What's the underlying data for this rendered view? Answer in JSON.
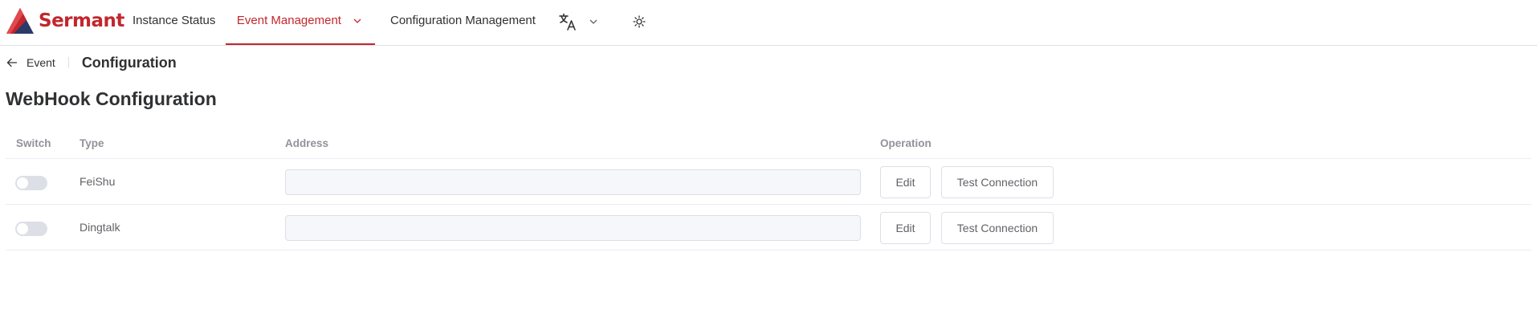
{
  "app": {
    "logo_text": "Sermant"
  },
  "nav": {
    "items": [
      {
        "label": "Instance Status"
      },
      {
        "label": "Event Management"
      },
      {
        "label": "Configuration Management"
      }
    ],
    "language_icon": "translate-icon",
    "theme_icon": "sun-icon"
  },
  "header": {
    "back_label": "Event",
    "title": "Configuration"
  },
  "section": {
    "title": "WebHook Configuration"
  },
  "table": {
    "columns": [
      "Switch",
      "Type",
      "Address",
      "Operation"
    ],
    "rows": [
      {
        "switch_on": false,
        "type": "FeiShu",
        "address": "",
        "edit_label": "Edit",
        "test_label": "Test Connection"
      },
      {
        "switch_on": false,
        "type": "Dingtalk",
        "address": "",
        "edit_label": "Edit",
        "test_label": "Test Connection"
      }
    ]
  },
  "colors": {
    "brand": "#c1272d",
    "logo_dark": "#2b3a67",
    "border": "#dcdfe6",
    "header_text": "#909399"
  }
}
